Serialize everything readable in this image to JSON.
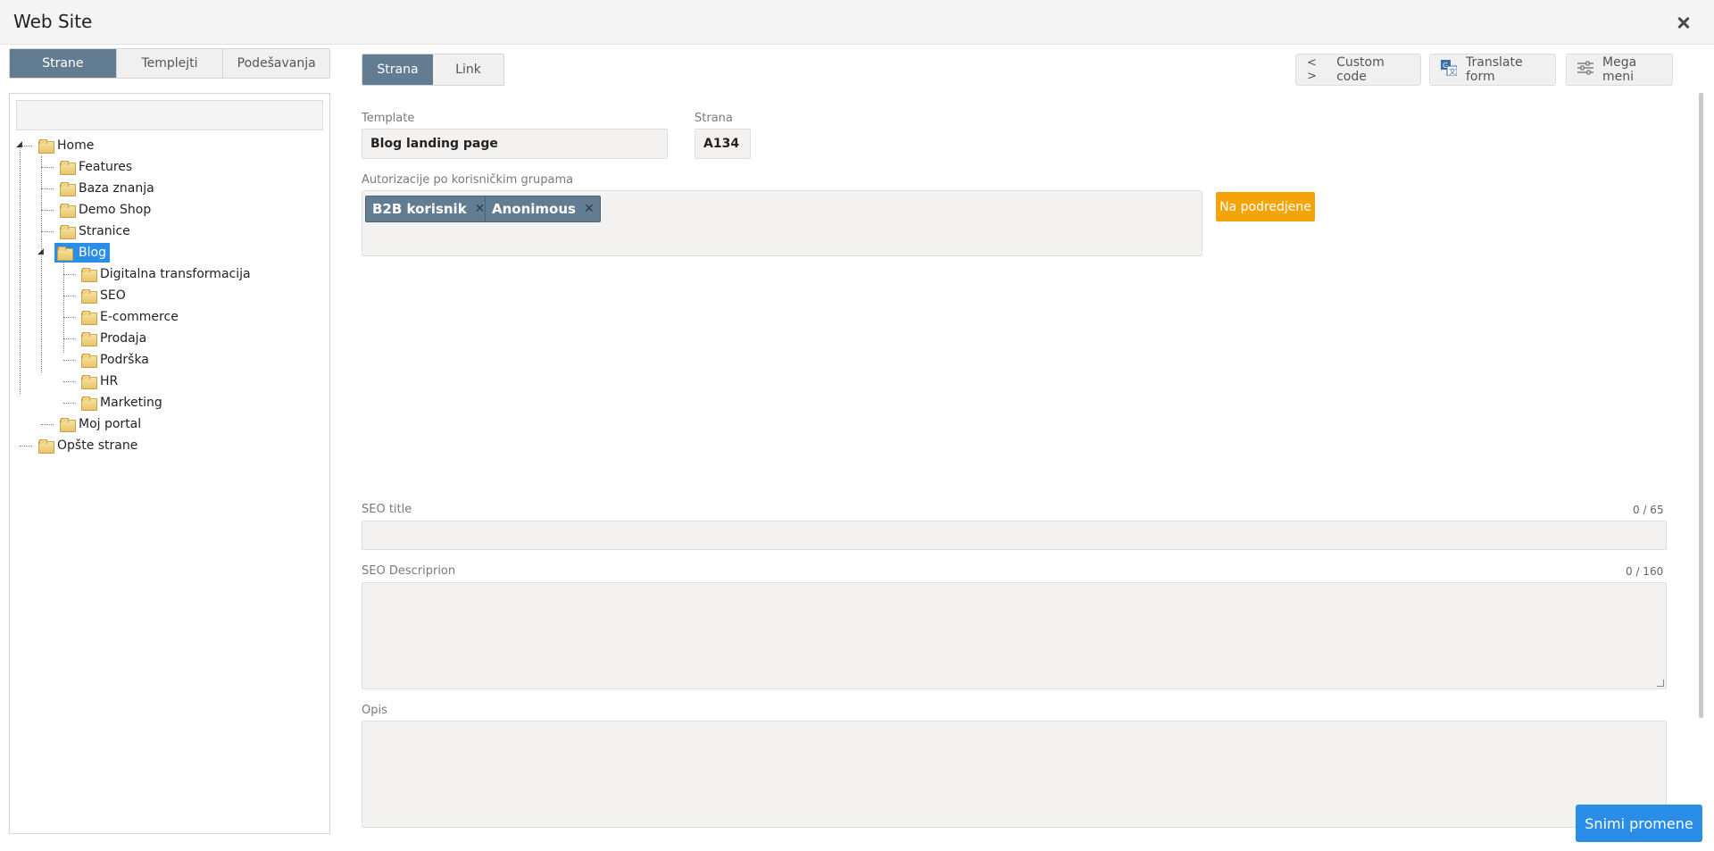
{
  "window": {
    "title": "Web Site"
  },
  "left_tabs": [
    {
      "label": "Strane",
      "active": true
    },
    {
      "label": "Templejti",
      "active": false
    },
    {
      "label": "Podešavanja",
      "active": false
    }
  ],
  "tree": {
    "nodes": [
      {
        "label": "Home",
        "level": 0,
        "expanded": true
      },
      {
        "label": "Features",
        "level": 1
      },
      {
        "label": "Baza znanja",
        "level": 1
      },
      {
        "label": "Demo Shop",
        "level": 1
      },
      {
        "label": "Stranice",
        "level": 1
      },
      {
        "label": "Blog",
        "level": 1,
        "selected": true,
        "expanded": true
      },
      {
        "label": "Digitalna transformacija",
        "level": 2
      },
      {
        "label": "SEO",
        "level": 2
      },
      {
        "label": "E-commerce",
        "level": 2
      },
      {
        "label": "Prodaja",
        "level": 2
      },
      {
        "label": "Podrška",
        "level": 2
      },
      {
        "label": "HR",
        "level": 2
      },
      {
        "label": "Marketing",
        "level": 2
      },
      {
        "label": "Moj portal",
        "level": 1
      },
      {
        "label": "Opšte strane",
        "level": 0
      }
    ]
  },
  "right_tabs": [
    {
      "label": "Strana",
      "active": true
    },
    {
      "label": "Link",
      "active": false
    }
  ],
  "toolbar": {
    "custom_code": {
      "label": "Custom code",
      "icon": "code-icon"
    },
    "translate_form": {
      "label": "Translate form",
      "icon": "translate-icon"
    },
    "mega_meni": {
      "label": "Mega meni",
      "icon": "sliders-icon"
    }
  },
  "form": {
    "template_label": "Template",
    "template_value": "Blog landing page",
    "strana_label": "Strana",
    "strana_value": "A134",
    "auth_label": "Autorizacije po korisničkim grupama",
    "auth_chips": [
      "B2B korisnik",
      "Anonimous"
    ],
    "na_podredjene": "Na podredjene",
    "seo_title_label": "SEO title",
    "seo_title_counter": "0 / 65",
    "seo_desc_label": "SEO Descriprion",
    "seo_desc_counter": "0 / 160",
    "opis_label": "Opis"
  },
  "save_button": "Snimi promene",
  "colors": {
    "active_tab": "#627d91",
    "primary": "#2a8ee8",
    "orange": "#f4a409"
  }
}
